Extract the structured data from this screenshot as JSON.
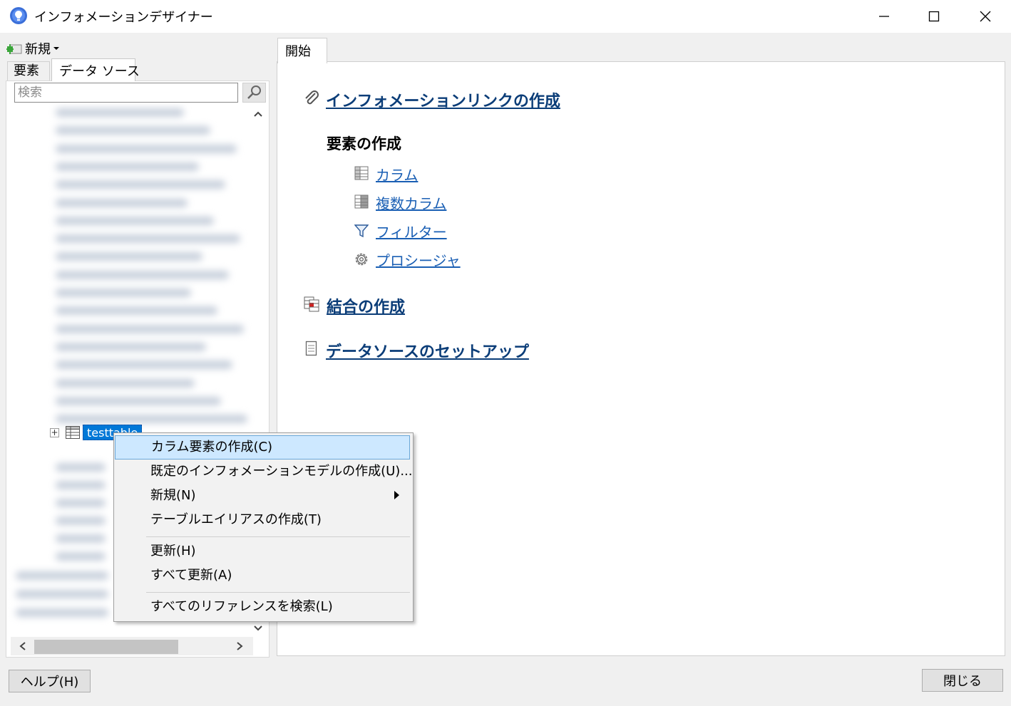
{
  "window": {
    "title": "インフォメーションデザイナー",
    "minimize_glyph": "—",
    "maximize_glyph": "□",
    "close_glyph": "✕"
  },
  "left": {
    "new_button": "新規",
    "tabs": [
      "要素",
      "データ ソース"
    ],
    "search": {
      "placeholder": "検索",
      "value": ""
    },
    "tree": {
      "selected_item": "testtable"
    }
  },
  "right": {
    "tab": "開始",
    "links": {
      "info_link": "インフォメーションリンクの作成",
      "section_heading": "要素の作成",
      "column": "カラム",
      "multi_column": "複数カラム",
      "filter": "フィルター",
      "procedure": "プロシージャ",
      "join": "結合の作成",
      "datasource_setup": "データソースのセットアップ"
    }
  },
  "context_menu": {
    "items": [
      "カラム要素の作成(C)",
      "既定のインフォメーションモデルの作成(U)...",
      "新規(N)",
      "テーブルエイリアスの作成(T)",
      "更新(H)",
      "すべて更新(A)",
      "すべてのリファレンスを検索(L)"
    ],
    "highlighted_index": 0
  },
  "bottom": {
    "help_button": "ヘルプ(H)",
    "close_button": "閉じる"
  },
  "colors": {
    "selection": "#0078d7",
    "link": "#0b3d78",
    "menu_highlight": "#cde8ff"
  }
}
